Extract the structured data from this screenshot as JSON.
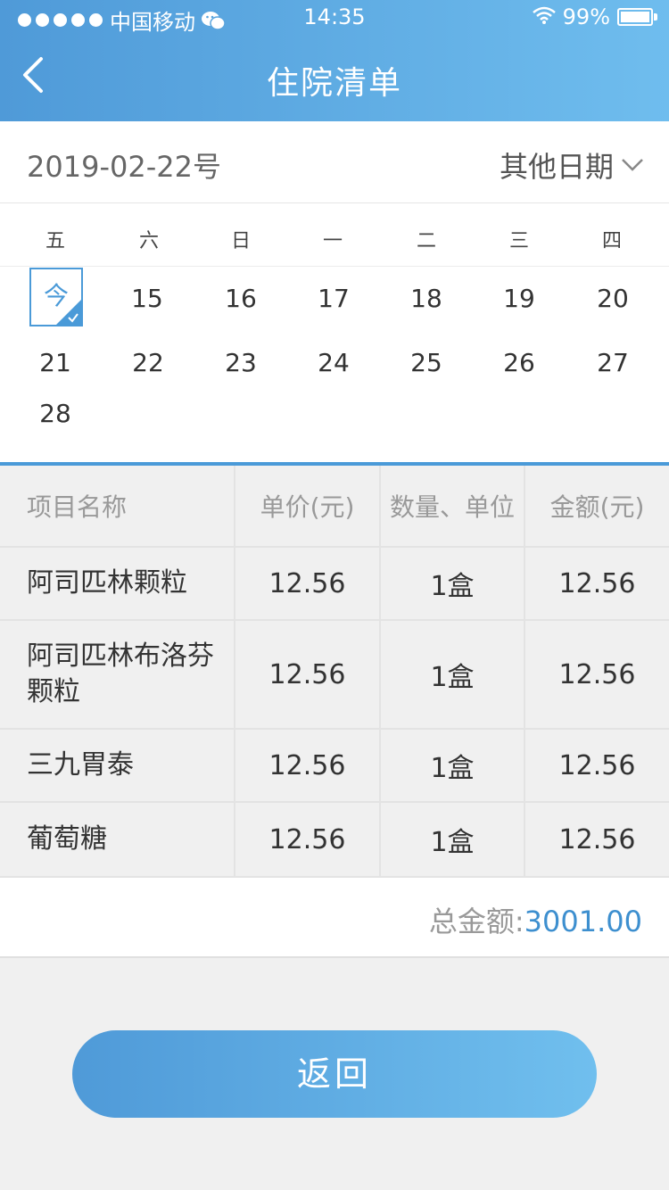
{
  "status_bar": {
    "carrier": "中国移动",
    "time": "14:35",
    "battery": "99%"
  },
  "header": {
    "title": "住院清单"
  },
  "date_bar": {
    "selected_date": "2019-02-22号",
    "other_date_label": "其他日期"
  },
  "calendar": {
    "weekdays": [
      "五",
      "六",
      "日",
      "一",
      "二",
      "三",
      "四"
    ],
    "today_label": "今",
    "days": [
      "15",
      "16",
      "17",
      "18",
      "19",
      "20",
      "21",
      "22",
      "23",
      "24",
      "25",
      "26",
      "27",
      "28"
    ]
  },
  "table": {
    "headers": [
      "项目名称",
      "单价(元)",
      "数量、单位",
      "金额(元)"
    ],
    "rows": [
      {
        "name": "阿司匹林颗粒",
        "price": "12.56",
        "qty": "1盒",
        "amount": "12.56"
      },
      {
        "name": "阿司匹林布洛芬颗粒",
        "price": "12.56",
        "qty": "1盒",
        "amount": "12.56"
      },
      {
        "name": "三九胃泰",
        "price": "12.56",
        "qty": "1盒",
        "amount": "12.56"
      },
      {
        "name": "葡萄糖",
        "price": "12.56",
        "qty": "1盒",
        "amount": "12.56"
      }
    ]
  },
  "total": {
    "label": "总金额:",
    "amount": "3001.00"
  },
  "footer": {
    "return_label": "返回"
  },
  "colors": {
    "accent": "#4a9ad8",
    "header_start": "#4f9ad8",
    "header_end": "#6fbdee"
  },
  "icons": [
    "signal-dots-icon",
    "wechat-icon",
    "wifi-icon",
    "battery-icon",
    "back-arrow-icon",
    "chevron-down-icon",
    "check-icon"
  ]
}
